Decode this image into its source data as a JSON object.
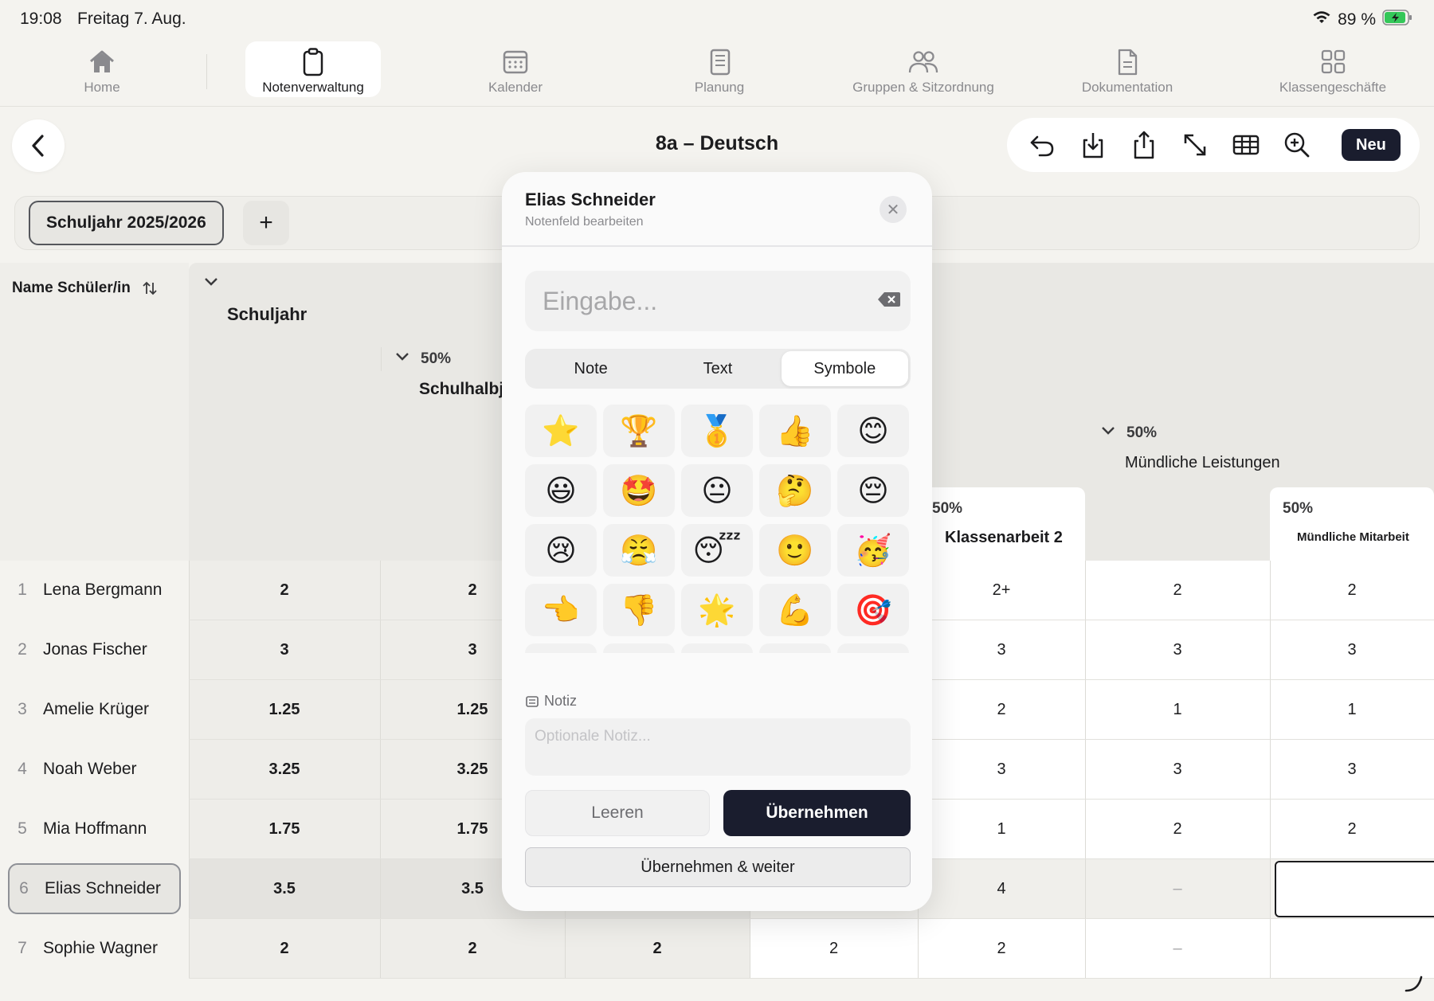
{
  "status": {
    "time": "19:08",
    "date": "Freitag 7. Aug.",
    "battery": "89 %"
  },
  "nav": [
    {
      "label": "Home",
      "icon": "home-icon"
    },
    {
      "label": "Notenverwaltung",
      "icon": "clipboard-icon"
    },
    {
      "label": "Kalender",
      "icon": "calendar-icon"
    },
    {
      "label": "Planung",
      "icon": "notebook-icon"
    },
    {
      "label": "Gruppen & Sitzordnung",
      "icon": "people-icon"
    },
    {
      "label": "Dokumentation",
      "icon": "document-icon"
    },
    {
      "label": "Klassengeschäfte",
      "icon": "grid-icon"
    }
  ],
  "header": {
    "title": "8a – Deutsch",
    "new_label": "Neu"
  },
  "year_tab": {
    "label": "Schuljahr 2025/2026",
    "add": "+"
  },
  "table": {
    "name_header": "Name Schüler/in",
    "group_schuljahr": "Schuljahr",
    "group_halbjahr": {
      "weight": "50%",
      "label": "Schulhalbj"
    },
    "group_muendlich": {
      "weight": "50%",
      "label": "Mündliche Leistungen"
    },
    "col_klassenarbeit2": {
      "weight": "50%",
      "label": "Klassenarbeit 2"
    },
    "col_mitarbeit": {
      "weight": "50%",
      "label": "Mündliche Mitarbeit"
    },
    "rows": [
      {
        "n": "1",
        "name": "Lena Bergmann",
        "c1": "2",
        "c2": "2",
        "c3": "",
        "c4": "",
        "c5": "2+",
        "c6": "2",
        "c7": "2"
      },
      {
        "n": "2",
        "name": "Jonas Fischer",
        "c1": "3",
        "c2": "3",
        "c3": "",
        "c4": "",
        "c5": "3",
        "c6": "3",
        "c7": "3"
      },
      {
        "n": "3",
        "name": "Amelie Krüger",
        "c1": "1.25",
        "c2": "1.25",
        "c3": "",
        "c4": "",
        "c5": "2",
        "c6": "1",
        "c7": "1"
      },
      {
        "n": "4",
        "name": "Noah Weber",
        "c1": "3.25",
        "c2": "3.25",
        "c3": "",
        "c4": "",
        "c5": "3",
        "c6": "3",
        "c7": "3"
      },
      {
        "n": "5",
        "name": "Mia Hoffmann",
        "c1": "1.75",
        "c2": "1.75",
        "c3": "",
        "c4": "",
        "c5": "1",
        "c6": "2",
        "c7": "2"
      },
      {
        "n": "6",
        "name": "Elias Schneider",
        "c1": "3.5",
        "c2": "3.5",
        "c3": "",
        "c4": "",
        "c5": "4",
        "c6": "–",
        "c7": ""
      },
      {
        "n": "7",
        "name": "Sophie Wagner",
        "c1": "2",
        "c2": "2",
        "c3": "2",
        "c4": "2",
        "c5": "2",
        "c6": "–",
        "c7": ""
      }
    ]
  },
  "modal": {
    "student": "Elias Schneider",
    "subtitle": "Notenfeld bearbeiten",
    "input_placeholder": "Eingabe...",
    "tabs": [
      "Note",
      "Text",
      "Symbole"
    ],
    "active_tab": "Symbole",
    "symbols": [
      "⭐",
      "🏆",
      "🥇",
      "👍",
      "😊",
      "😃",
      "🤩",
      "😐",
      "🤔",
      "😔",
      "😢",
      "😤",
      "😴",
      "🙂",
      "🥳",
      "👈",
      "👎",
      "🌟",
      "💪",
      "🎯",
      "👏",
      "✅",
      "☑️",
      "❌",
      "➖"
    ],
    "note_label": "Notiz",
    "note_placeholder": "Optionale Notiz...",
    "clear_label": "Leeren",
    "apply_label": "Übernehmen",
    "apply_next_label": "Übernehmen & weiter"
  },
  "colors": {
    "primary_dark": "#1a1d2e",
    "battery_green": "#34c759"
  }
}
